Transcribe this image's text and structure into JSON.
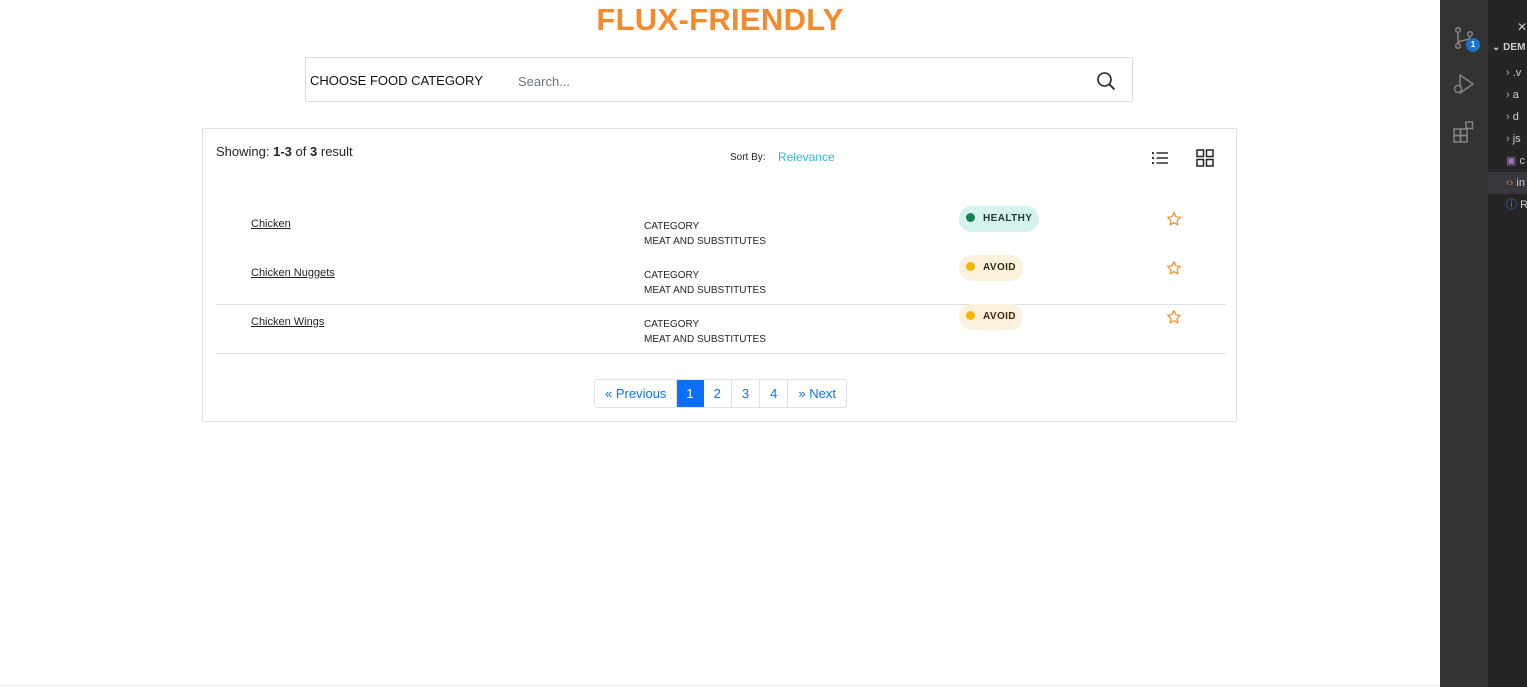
{
  "app": {
    "title": "FLUX-FRIENDLY",
    "search": {
      "category_label": "CHOOSE FOOD CATEGORY",
      "placeholder": "Search...",
      "value": ""
    },
    "results": {
      "showing_prefix": "Showing:",
      "range": "1-3",
      "of": "of",
      "total": "3",
      "suffix": "result",
      "sort_by_label": "Sort By:",
      "sort_value": "Relevance"
    },
    "items": [
      {
        "name": "Chicken",
        "category_label": "CATEGORY",
        "category": "MEAT AND SUBSTITUTES",
        "status": "HEALTHY"
      },
      {
        "name": "Chicken Nuggets",
        "category_label": "CATEGORY",
        "category": "MEAT AND SUBSTITUTES",
        "status": "AVOID"
      },
      {
        "name": "Chicken Wings",
        "category_label": "CATEGORY",
        "category": "MEAT AND SUBSTITUTES",
        "status": "AVOID"
      }
    ],
    "pagination": {
      "previous": "« Previous",
      "pages": [
        "1",
        "2",
        "3",
        "4"
      ],
      "active": "1",
      "next": "» Next"
    },
    "colors": {
      "brand": "#f28a2e",
      "link": "#0d6efd",
      "sort": "#34b5d6",
      "healthy_dot": "#1a7f52",
      "avoid_dot": "#f7b500"
    }
  },
  "vscode": {
    "scm_badge": "1",
    "explorer_header": "DEM",
    "tree": [
      ".v",
      "a",
      "d",
      "js",
      "c",
      "in",
      "R"
    ]
  }
}
